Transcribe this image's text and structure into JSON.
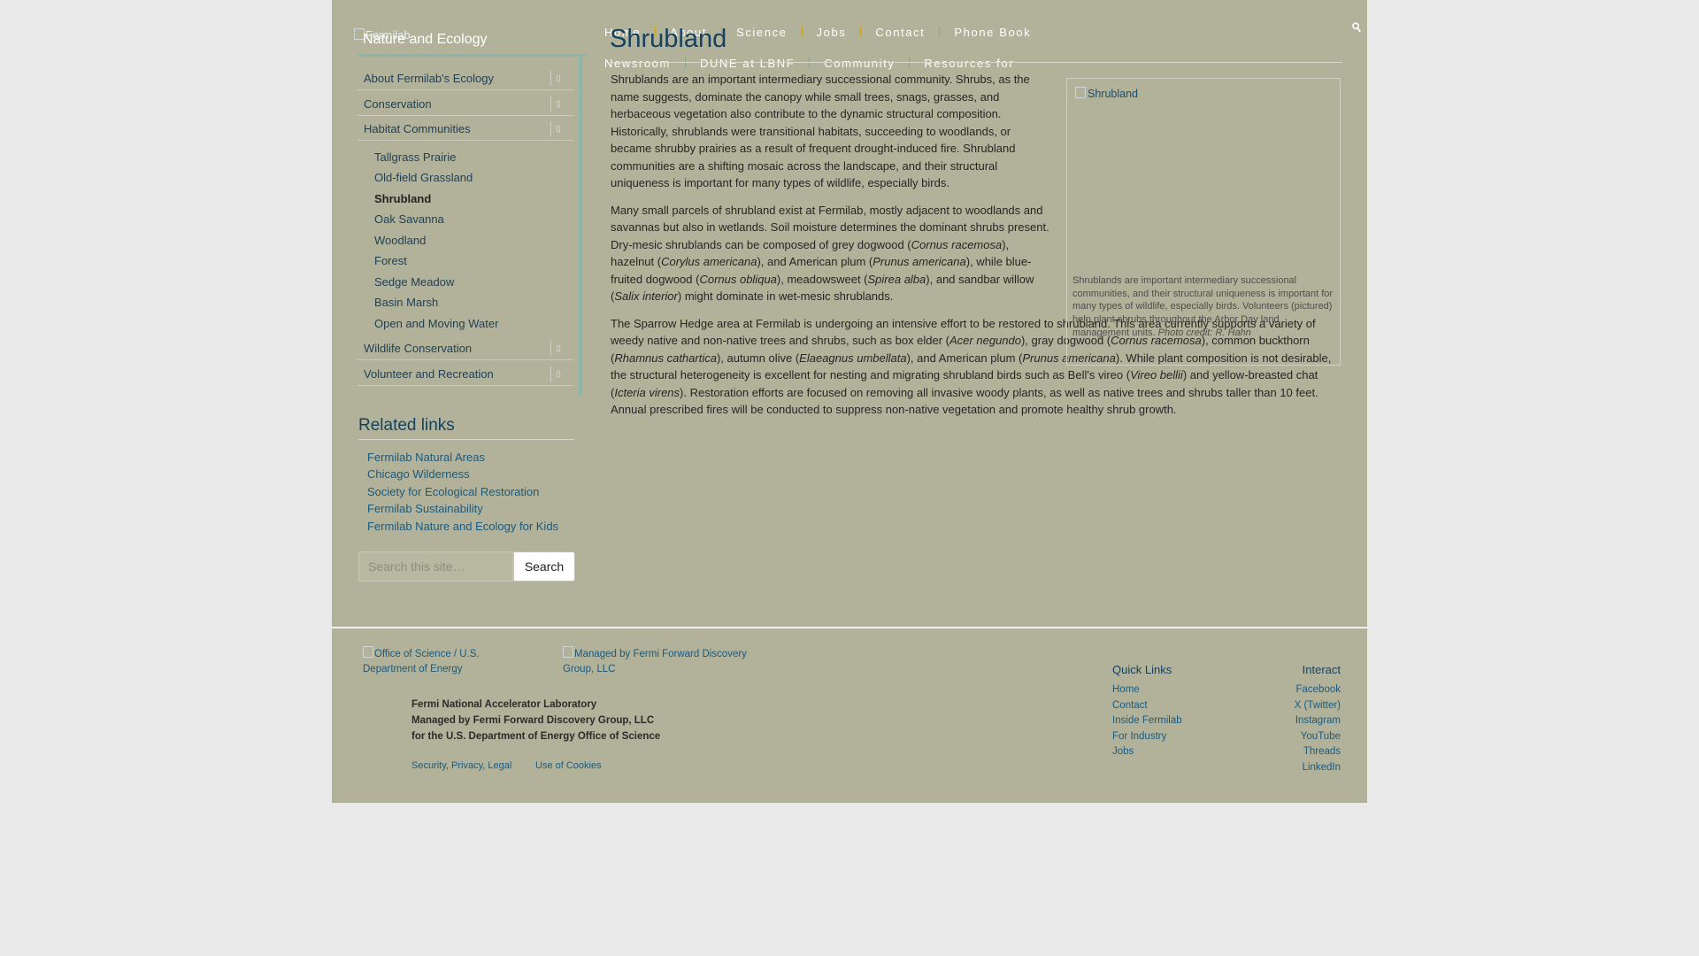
{
  "header": {
    "logo_alt": "Fermilab",
    "site_title": "Nature and Ecology",
    "search_icon": "search-icon",
    "nav_row1": [
      "Home",
      "About",
      "Science",
      "Jobs",
      "Contact",
      "Phone Book"
    ],
    "nav_row2": [
      "Newsroom",
      "DUNE at LBNF",
      "Community",
      "Resources for"
    ]
  },
  "sidebar": {
    "sections": [
      {
        "label": "About Fermilab's Ecology"
      },
      {
        "label": "Conservation"
      },
      {
        "label": "Habitat Communities"
      }
    ],
    "habitat_items": [
      "Tallgrass Prairie",
      "Old-field Grassland",
      "Shrubland",
      "Oak Savanna",
      "Woodland",
      "Forest",
      "Sedge Meadow",
      "Basin Marsh",
      "Open and Moving Water"
    ],
    "active_item": "Shrubland",
    "sections_after": [
      {
        "label": "Wildlife Conservation"
      },
      {
        "label": "Volunteer and Recreation"
      }
    ],
    "related_title": "Related links",
    "related_links": [
      "Fermilab Natural Areas",
      "Chicago Wilderness",
      "Society for Ecological Restoration",
      "Fermilab Sustainability",
      "Fermilab Nature and Ecology for Kids"
    ],
    "search_placeholder": "Search this site…",
    "search_button": "Search"
  },
  "main": {
    "title": "Shrubland",
    "p1": "Shrublands are an important intermediary successional community. Shrubs, as the name suggests, dominate the canopy while small trees, snags, grasses, and herbaceous vegetation also contribute to the dynamic structural composition. Historically, shrublands were transitional habitats, succeeding to woodlands, or became shrubby prairies as a result of frequent drought-induced fire. Shrubland communities are a shifting mosaic across the landscape, and their structural uniqueness is important for many types of wildlife, especially birds.",
    "p2": [
      {
        "t": "Many small parcels of shrubland exist at Fermilab, mostly adjacent to woodlands and savannas but also in wetlands. Soil moisture determines the dominant shrubs present. Dry-mesic shrublands can be composed of grey dogwood ("
      },
      {
        "t": "Cornus racemosa",
        "i": true
      },
      {
        "t": "), hazelnut ("
      },
      {
        "t": "Corylus americana",
        "i": true
      },
      {
        "t": "), and American plum ("
      },
      {
        "t": "Prunus americana",
        "i": true
      },
      {
        "t": "), while blue-fruited dogwood ("
      },
      {
        "t": "Cornus obliqua",
        "i": true
      },
      {
        "t": "), meadowsweet ("
      },
      {
        "t": "Spirea alba",
        "i": true
      },
      {
        "t": "), and sandbar willow ("
      },
      {
        "t": "Salix interior",
        "i": true
      },
      {
        "t": ") might dominate in wet-mesic shrublands."
      }
    ],
    "p3": [
      {
        "t": "The Sparrow Hedge area at Fermilab is undergoing an intensive effort to be restored to shrubland. This area currently supports a variety of weedy native and non-native trees and shrubs, such as box elder ("
      },
      {
        "t": "Acer negundo",
        "i": true
      },
      {
        "t": "), gray dogwood ("
      },
      {
        "t": "Cornus racemosa",
        "i": true
      },
      {
        "t": "), common buckthorn ("
      },
      {
        "t": "Rhamnus cathartica",
        "i": true
      },
      {
        "t": "), autumn olive ("
      },
      {
        "t": "Elaeagnus umbellata",
        "i": true
      },
      {
        "t": "), and American plum ("
      },
      {
        "t": "Prunus americana",
        "i": true
      },
      {
        "t": "). While plant composition is not desirable, the structural heterogeneity is excellent for nesting and migrating shrubland birds such as Bell's vireo ("
      },
      {
        "t": "Vireo bellii",
        "i": true
      },
      {
        "t": ") and yellow-breasted chat ("
      },
      {
        "t": "Icteria virens",
        "i": true
      },
      {
        "t": "). Restoration efforts are focused on removing all invasive woody plants, as well as native trees and shrubs taller than 10 feet. Annual prescribed fires will be conducted to suppress non-native vegetation and promote healthy shrub growth."
      }
    ],
    "figure_alt": "Shrubland",
    "figure_caption": "Shrublands are important intermediary successional communities, and their structural uniqueness is important for many types of wildlife, especially birds. Volunteers (pictured) help plant shrubs throughout the Arbor Day land management units.",
    "figure_credit": "Photo credit: R. Hahn"
  },
  "footer": {
    "logo1_alt": "Office of Science / U.S. Department of Energy",
    "logo2_alt": "Managed by Fermi Forward Discovery Group, LLC",
    "org_line1": "Fermi National Accelerator Laboratory",
    "org_line2": "Managed by Fermi Forward Discovery Group, LLC",
    "org_line3": "for the U.S. Department of Energy Office of Science",
    "legal_links": [
      "Security, Privacy, Legal",
      "Use of Cookies"
    ],
    "quick_links_title": "Quick Links",
    "quick_links": [
      "Home",
      "Contact",
      "Inside Fermilab",
      "For Industry",
      "Jobs"
    ],
    "interact_title": "Interact",
    "interact_links": [
      "Facebook",
      "X (Twitter)",
      "Instagram",
      "YouTube",
      "Threads",
      "LinkedIn"
    ]
  }
}
